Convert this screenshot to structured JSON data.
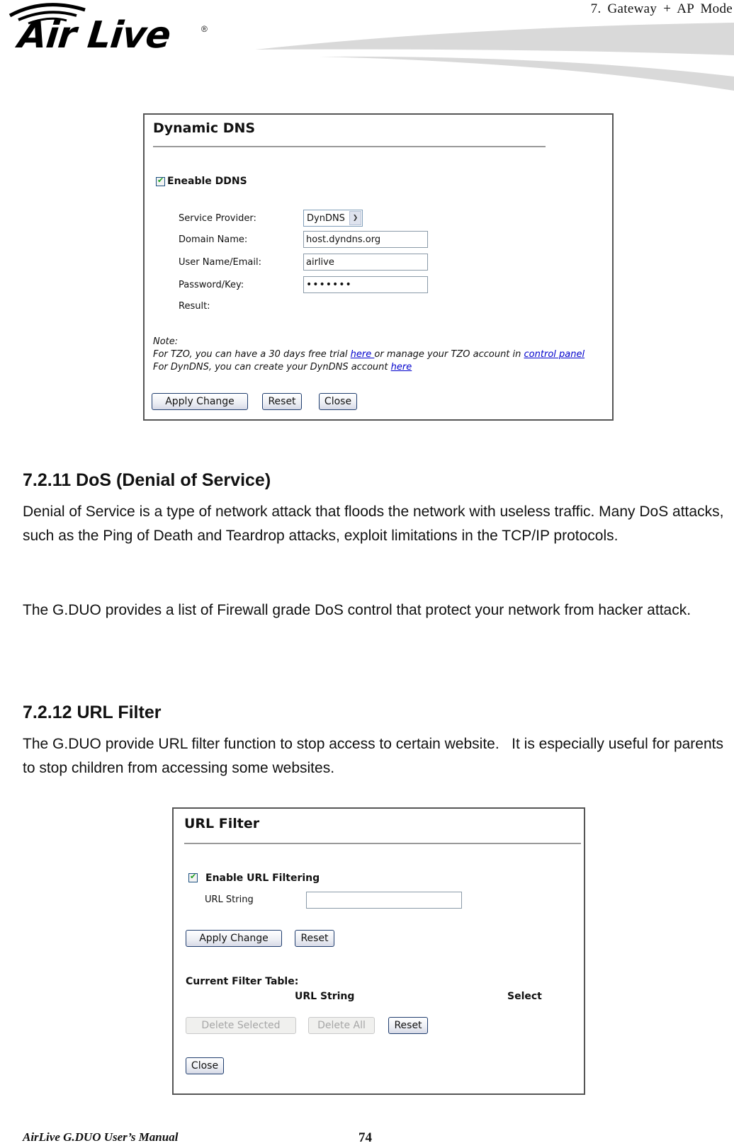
{
  "header": {
    "logo_text": "Air Live",
    "logo_reg": "®",
    "chapter": "7. Gateway + AP Mode"
  },
  "ddns_panel": {
    "title": "Dynamic DNS",
    "enable_label": "Eneable DDNS",
    "enable_checked": true,
    "fields": {
      "service_provider_label": "Service Provider:",
      "service_provider_value": "DynDNS",
      "domain_label": "Domain Name:",
      "domain_value": "host.dyndns.org",
      "user_label": "User Name/Email:",
      "user_value": "airlive",
      "password_label": "Password/Key:",
      "password_value": "•••••••",
      "result_label": "Result:"
    },
    "note": {
      "title": "Note:",
      "line1_prefix": "For TZO, you can have a 30 days free trial ",
      "line1_link1": "here ",
      "line1_middle": "or manage your TZO account in ",
      "line1_link2": "control panel",
      "line2_prefix": "For DynDNS, you can create your DynDNS account ",
      "line2_link": "here"
    },
    "buttons": {
      "apply": "Apply Change",
      "reset": "Reset",
      "close": "Close"
    }
  },
  "section_dos": {
    "heading": "7.2.11 DoS (Denial of Service)",
    "para1": "Denial of Service is a type of network attack that floods the network with useless traffic. Many DoS attacks, such as the Ping of Death and Teardrop attacks, exploit limitations in the TCP/IP protocols.",
    "para2": "The G.DUO provides a list of Firewall grade DoS control that protect your network from hacker attack."
  },
  "section_url": {
    "heading": "7.2.12 URL Filter",
    "para1": "The G.DUO provide URL filter function to stop access to certain website.   It is especially useful for parents to stop children from accessing some websites."
  },
  "url_panel": {
    "title": "URL Filter",
    "enable_label": "Enable URL Filtering",
    "enable_checked": true,
    "url_string_label": "URL String",
    "url_string_value": "",
    "buttons": {
      "apply": "Apply Change",
      "reset": "Reset",
      "delete_selected": "Delete Selected",
      "delete_all": "Delete All",
      "reset2": "Reset",
      "close": "Close"
    },
    "table": {
      "title": "Current Filter Table:",
      "columns": [
        "URL String",
        "Select"
      ],
      "rows": []
    }
  },
  "footer": {
    "manual": "AirLive G.DUO User’s Manual",
    "page": "74"
  }
}
